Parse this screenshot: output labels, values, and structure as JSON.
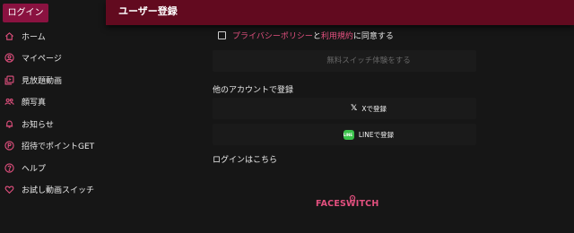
{
  "sidebar": {
    "login_label": "ログイン",
    "items": [
      {
        "label": "ホーム",
        "icon": "home-icon"
      },
      {
        "label": "マイページ",
        "icon": "user-circle-icon"
      },
      {
        "label": "見放題動画",
        "icon": "video-library-icon"
      },
      {
        "label": "顔写真",
        "icon": "people-icon"
      },
      {
        "label": "お知らせ",
        "icon": "bell-icon"
      },
      {
        "label": "招待でポイントGET",
        "icon": "points-icon"
      },
      {
        "label": "ヘルプ",
        "icon": "help-icon"
      },
      {
        "label": "お試し動画スイッチ",
        "icon": "heart-icon"
      }
    ]
  },
  "header": {
    "title": "ユーザー登録"
  },
  "terms": {
    "privacy_link": "プライバシーポリシー",
    "and_text": "と",
    "terms_link": "利用規約",
    "agree_text": "に同意する",
    "checked": false
  },
  "start_button": {
    "label": "無料スイッチ体験をする"
  },
  "other_accounts": {
    "title": "他のアカウントで登録",
    "x_label": "Xで登録",
    "line_label": "LINEで登録",
    "line_icon_text": "LINE"
  },
  "login_link": "ログインはこちら",
  "logo": {
    "text": "FACESWITCH"
  },
  "colors": {
    "accent": "#e3507f",
    "header_bg": "#620a1f",
    "login_button_bg": "#8a1240",
    "background": "#161616",
    "line_green": "#39c24a"
  }
}
